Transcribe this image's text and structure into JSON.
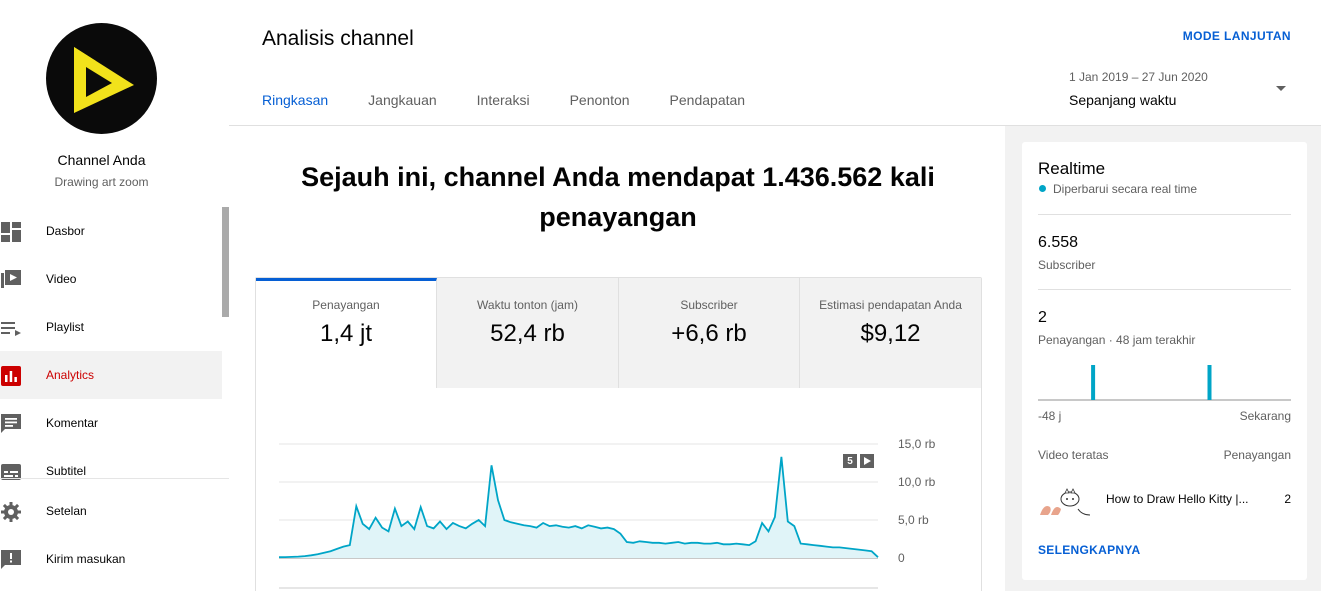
{
  "channel": {
    "name": "Channel Anda",
    "subtitle": "Drawing art zoom"
  },
  "sidebar": {
    "items": [
      {
        "label": "Dasbor",
        "icon": "dashboard-icon"
      },
      {
        "label": "Video",
        "icon": "video-icon"
      },
      {
        "label": "Playlist",
        "icon": "playlist-icon"
      },
      {
        "label": "Analytics",
        "icon": "analytics-icon",
        "active": true
      },
      {
        "label": "Komentar",
        "icon": "comment-icon"
      },
      {
        "label": "Subtitel",
        "icon": "subtitles-icon"
      },
      {
        "label": "Setelan",
        "icon": "gear-icon"
      },
      {
        "label": "Kirim masukan",
        "icon": "feedback-icon"
      }
    ]
  },
  "header": {
    "title": "Analisis channel",
    "mode_link": "MODE LANJUTAN",
    "date_range": "1 Jan 2019 – 27 Jun 2020",
    "date_select": "Sepanjang waktu",
    "tabs": [
      "Ringkasan",
      "Jangkauan",
      "Interaksi",
      "Penonton",
      "Pendapatan"
    ]
  },
  "main": {
    "headline": "Sejauh ini, channel Anda mendapat 1.436.562 kali penayangan",
    "metrics": [
      {
        "label": "Penayangan",
        "value": "1,4 jt"
      },
      {
        "label": "Waktu tonton (jam)",
        "value": "52,4 rb"
      },
      {
        "label": "Subscriber",
        "value": "+6,6 rb"
      },
      {
        "label": "Estimasi pendapatan Anda",
        "value": "$9,12"
      }
    ],
    "badge_count": "5"
  },
  "chart_data": {
    "type": "area",
    "yticks": [
      "15,0 rb",
      "10,0 rb",
      "5,0 rb",
      "0"
    ],
    "ylim": [
      0,
      15000
    ],
    "x_range": [
      "2019-01-01",
      "2020-06-27"
    ],
    "series": [
      {
        "values": [
          100,
          120,
          150,
          180,
          250,
          350,
          500,
          700,
          900,
          1200,
          1500,
          1700,
          6800,
          4500,
          3800,
          5300,
          4000,
          3500,
          6500,
          4200,
          4800,
          3800,
          6700,
          4200,
          3900,
          4800,
          3800,
          4600,
          4200,
          3900,
          4500,
          5000,
          4200,
          12200,
          7600,
          5000,
          4700,
          4500,
          4300,
          4200,
          4000,
          4600,
          4200,
          4300,
          4100,
          4000,
          4200,
          3900,
          4300,
          4100,
          3900,
          4000,
          3800,
          3200,
          2100,
          2000,
          2200,
          2100,
          2000,
          2000,
          1900,
          2000,
          2100,
          1900,
          2000,
          2000,
          1900,
          1900,
          2000,
          1800,
          1800,
          1900,
          1800,
          1700,
          2200,
          4600,
          3500,
          5400,
          13300,
          4800,
          4200,
          1900,
          1800,
          1700,
          1600,
          1500,
          1400,
          1400,
          1300,
          1200,
          1100,
          1000,
          900,
          100
        ]
      }
    ]
  },
  "realtime": {
    "title": "Realtime",
    "subtitle": "Diperbarui secara real time",
    "subscribers": "6.558",
    "subscribers_label": "Subscriber",
    "views": "2",
    "views_label": "Penayangan · 48 jam terakhir",
    "axis_left": "-48 j",
    "axis_right": "Sekarang",
    "top_label": "Video teratas",
    "top_views_label": "Penayangan",
    "video_title": "How to Draw Hello Kitty |...",
    "video_views": "2",
    "more_link": "SELENGKAPNYA",
    "bars": [
      1,
      1
    ]
  },
  "colors": {
    "accent": "#065fd4",
    "active_nav": "#cc0000",
    "chart_line": "#00a5c7",
    "chart_fill": "#e0f4f8"
  }
}
